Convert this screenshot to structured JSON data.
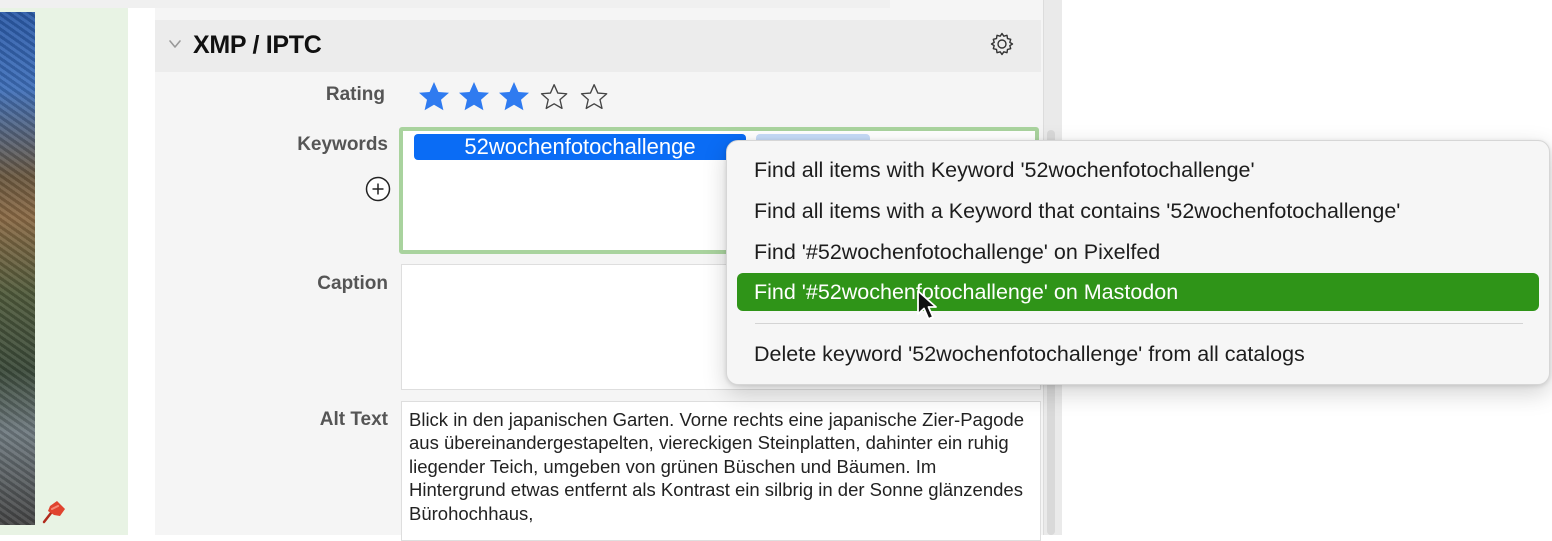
{
  "section": {
    "title": "XMP / IPTC"
  },
  "fields": {
    "rating_label": "Rating",
    "rating_value": 3,
    "rating_max": 5,
    "keywords_label": "Keywords",
    "keywords": [
      "52wochenfotochallenge"
    ],
    "caption_label": "Caption",
    "caption_value": "",
    "alt_text_label": "Alt Text",
    "alt_text_value": "Blick in den japanischen Garten. Vorne rechts eine japanische Zier-Pagode aus übereinandergestapelten, viereckigen Steinplatten, dahinter ein ruhig liegender Teich, umgeben von grünen Büschen und Bäumen. Im Hintergrund etwas entfernt als Kontrast ein silbrig in der Sonne glänzendes Bürohochhaus,"
  },
  "context_menu": {
    "items": [
      {
        "label": "Find all items with Keyword '52wochenfotochallenge'"
      },
      {
        "label": "Find all items with a Keyword that contains '52wochenfotochallenge'"
      },
      {
        "label": "Find '#52wochenfotochallenge' on Pixelfed"
      },
      {
        "label": "Find '#52wochenfotochallenge' on Mastodon",
        "highlighted": true
      },
      {
        "label": "Delete keyword '52wochenfotochallenge' from all catalogs"
      }
    ]
  },
  "icons": {
    "section_chevron": "chevron-down-icon",
    "settings": "gear-icon",
    "add_keyword": "plus-circle-icon",
    "pin": "pushpin-icon",
    "cursor": "mouse-pointer-icon"
  },
  "colors": {
    "star_filled": "#2f7bf0",
    "token_selected": "#0a6cf5",
    "menu_highlight": "#2f9418",
    "field_focus_border": "#a9d39e",
    "sidebar_bg": "#e8f3e4"
  }
}
